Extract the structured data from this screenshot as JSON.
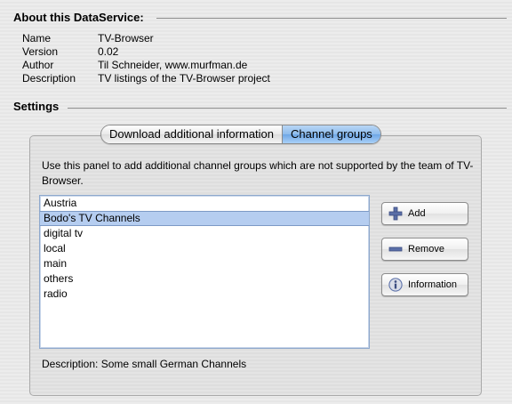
{
  "about": {
    "title": "About this DataService:",
    "rows": [
      {
        "key": "Name",
        "value": "TV-Browser"
      },
      {
        "key": "Version",
        "value": "0.02"
      },
      {
        "key": "Author",
        "value": "Til Schneider, www.murfman.de"
      },
      {
        "key": "Description",
        "value": "TV listings of the TV-Browser project"
      }
    ]
  },
  "settings": {
    "title": "Settings",
    "tabs": [
      {
        "label": "Download additional information",
        "active": false
      },
      {
        "label": "Channel groups",
        "active": true
      }
    ],
    "panel_text": "Use this panel to add additional channel groups which are not supported by the team of TV-Browser.",
    "groups": [
      "Austria",
      "Bodo's TV Channels",
      "digital tv",
      "local",
      "main",
      "others",
      "radio"
    ],
    "selected_group": "Bodo's TV Channels",
    "buttons": {
      "add": "Add",
      "remove": "Remove",
      "information": "Information"
    },
    "description_label": "Description:",
    "description_value": "Some small German Channels"
  },
  "icons": {
    "add": "plus-icon",
    "remove": "minus-icon",
    "information": "info-icon"
  },
  "colors": {
    "active_tab": "#8dbbec",
    "selection": "#b5cdf0",
    "icon_blue": "#5a6fa8"
  }
}
